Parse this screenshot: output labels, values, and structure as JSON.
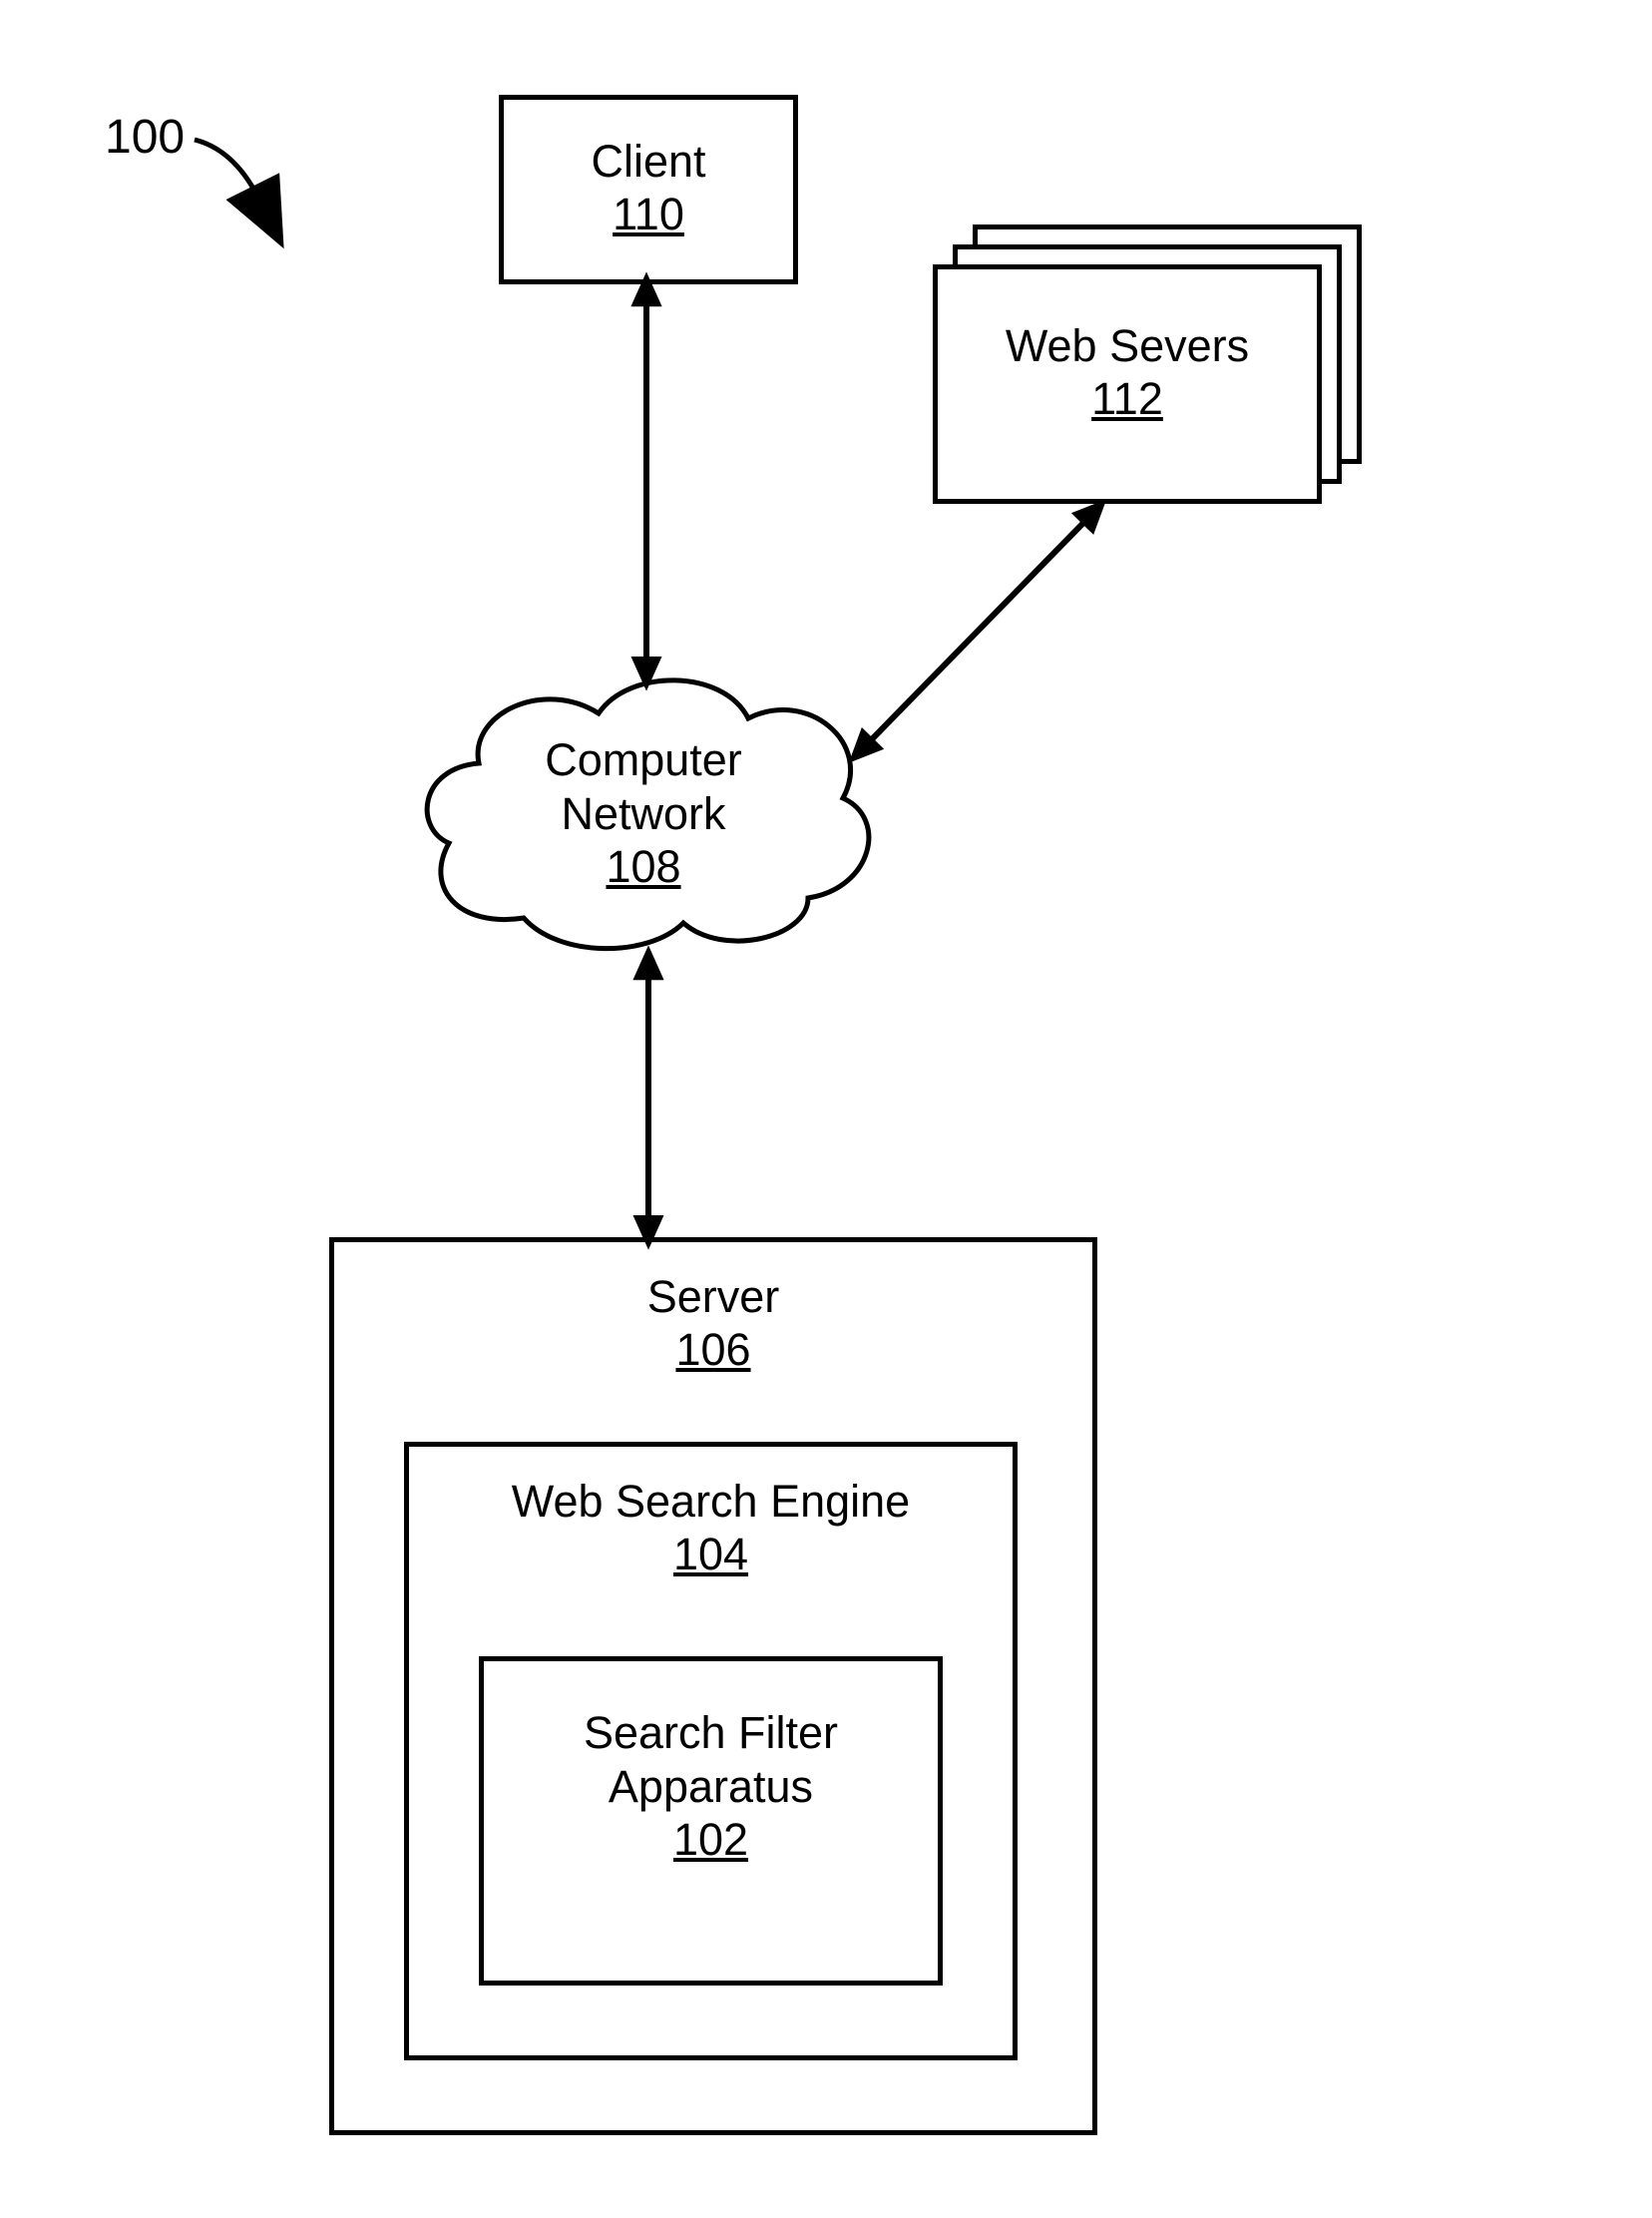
{
  "figure": {
    "number": "100"
  },
  "client": {
    "title": "Client",
    "num": "110"
  },
  "webservers": {
    "title": "Web Severs",
    "num": "112"
  },
  "network": {
    "line1": "Computer",
    "line2": "Network",
    "num": "108"
  },
  "server": {
    "title": "Server",
    "num": "106"
  },
  "engine": {
    "title": "Web Search Engine",
    "num": "104"
  },
  "apparatus": {
    "line1": "Search Filter",
    "line2": "Apparatus",
    "num": "102"
  }
}
